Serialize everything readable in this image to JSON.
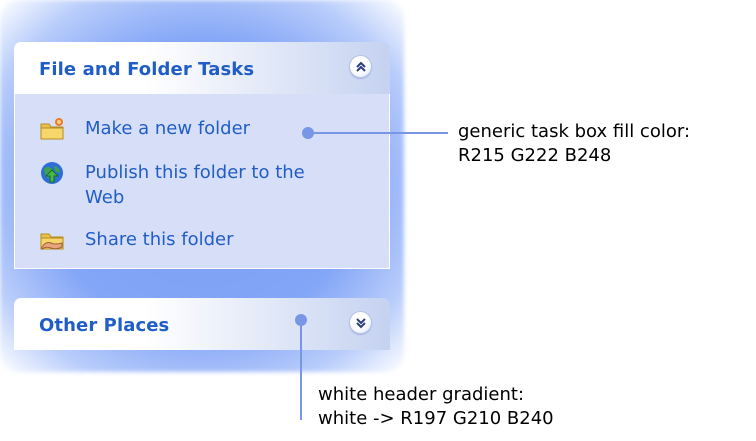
{
  "panels": [
    {
      "title": "File and Folder Tasks",
      "state_icon": "chevron-up-double-icon",
      "items": [
        {
          "label": "Make a new folder",
          "icon": "new-folder-icon"
        },
        {
          "label": "Publish this folder to the Web",
          "icon": "publish-web-icon"
        },
        {
          "label": "Share this folder",
          "icon": "share-folder-icon"
        }
      ]
    },
    {
      "title": "Other Places",
      "state_icon": "chevron-down-double-icon"
    }
  ],
  "annotations": {
    "fill": {
      "line1": "generic task box fill color:",
      "line2": "R215 G222 B248"
    },
    "header": {
      "line1": "white header gradient:",
      "line2": "white -> R197 G210 B240"
    }
  },
  "colors": {
    "task_fill": "#d7def8",
    "header_gradient_end": "#c5d2f0",
    "link_blue": "#215dc6",
    "callout": "#7896e6"
  }
}
